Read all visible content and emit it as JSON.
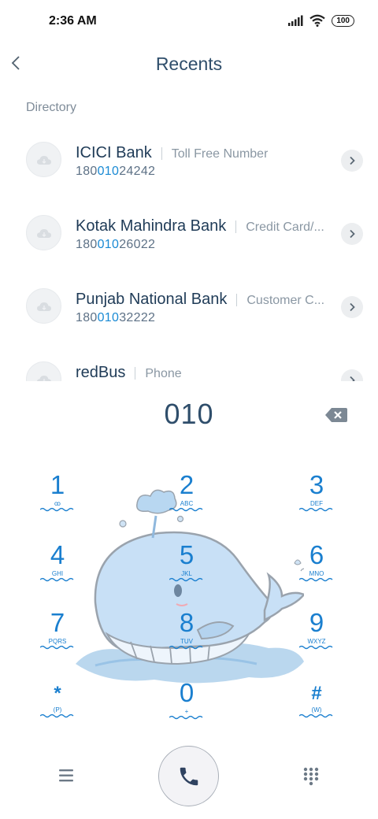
{
  "status": {
    "time": "2:36 AM",
    "battery": "100"
  },
  "header": {
    "title": "Recents"
  },
  "section": {
    "label": "Directory"
  },
  "recents": [
    {
      "name": "ICICI Bank",
      "tag": "Toll Free Number",
      "number_prefix": "180",
      "number_match": "010",
      "number_suffix": "24242"
    },
    {
      "name": "Kotak Mahindra Bank",
      "tag": "Credit Card/...",
      "number_prefix": "180",
      "number_match": "010",
      "number_suffix": "26022"
    },
    {
      "name": "Punjab National Bank",
      "tag": "Customer C...",
      "number_prefix": "180",
      "number_match": "010",
      "number_suffix": "32222"
    },
    {
      "name": "redBus",
      "tag": "Phone",
      "number_prefix": "",
      "number_match": "",
      "number_suffix": ""
    }
  ],
  "dialer": {
    "input": "010"
  },
  "keypad": [
    {
      "digit": "1",
      "letters": "ꝏ"
    },
    {
      "digit": "2",
      "letters": "ABC"
    },
    {
      "digit": "3",
      "letters": "DEF"
    },
    {
      "digit": "4",
      "letters": "GHI"
    },
    {
      "digit": "5",
      "letters": "JKL"
    },
    {
      "digit": "6",
      "letters": "MNO"
    },
    {
      "digit": "7",
      "letters": "PQRS"
    },
    {
      "digit": "8",
      "letters": "TUV"
    },
    {
      "digit": "9",
      "letters": "WXYZ"
    },
    {
      "digit": "*",
      "letters": "(P)"
    },
    {
      "digit": "0",
      "letters": "+"
    },
    {
      "digit": "#",
      "letters": "(W)"
    }
  ],
  "colors": {
    "accent": "#1a7fcf",
    "highlight": "#1a8ad4",
    "title": "#2f4e6b",
    "muted": "#8a97a3"
  },
  "icons": {
    "back": "chevron-left-icon",
    "detail": "chevron-right-icon",
    "backspace": "backspace-icon",
    "menu": "hamburger-icon",
    "call": "phone-icon",
    "keypad": "dialpad-icon"
  }
}
